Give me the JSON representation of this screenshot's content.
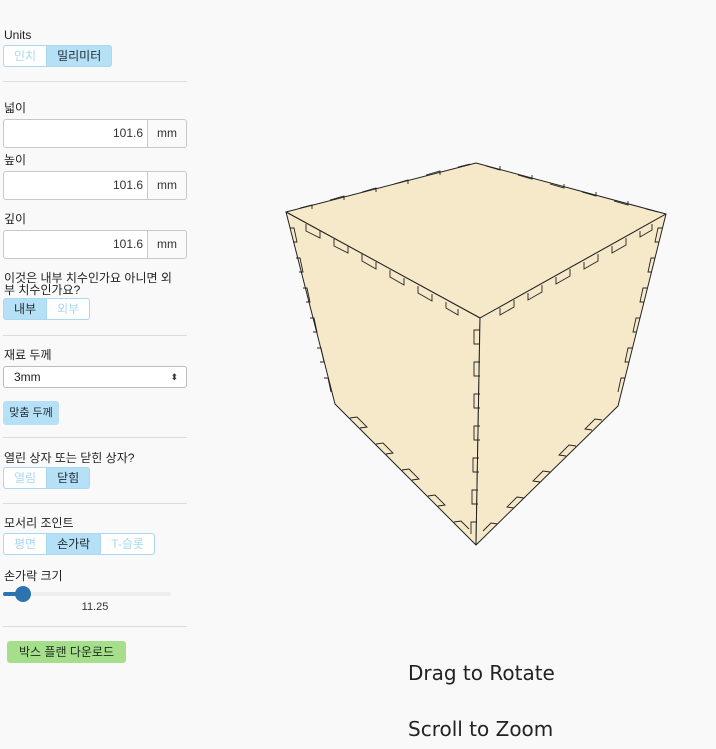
{
  "units": {
    "label": "Units",
    "options": [
      "인치",
      "밀리미터"
    ],
    "selected": 1
  },
  "width": {
    "label": "넓이",
    "value": "101.6",
    "unit": "mm"
  },
  "height": {
    "label": "높이",
    "value": "101.6",
    "unit": "mm"
  },
  "depth": {
    "label": "깊이",
    "value": "101.6",
    "unit": "mm"
  },
  "dimension_mode": {
    "label_line1": "이것은 내부 치수인가요 아니면 외",
    "label_line2": "부 치수인가요?",
    "options": [
      "내부",
      "외부"
    ],
    "selected": 0
  },
  "material": {
    "label": "재료 두께",
    "value": "3mm"
  },
  "fit_button": "맞춤 두께",
  "box_type": {
    "label": "열린 상자 또는 닫힌 상자?",
    "options": [
      "열림",
      "닫힘"
    ],
    "selected": 1
  },
  "joint": {
    "label": "모서리 조인트",
    "options": [
      "평면",
      "손가락",
      "T-슬롯"
    ],
    "selected": 1
  },
  "finger": {
    "label": "손가락 크기",
    "value": "11.25",
    "fraction": 0.12
  },
  "download_button": "박스 플랜 다운로드",
  "viewer": {
    "drag_hint": "Drag to Rotate",
    "zoom_hint": "Scroll to Zoom"
  },
  "colors": {
    "accent": "#b5e0f6",
    "download": "#a6df8c",
    "slider": "#2c73b0",
    "box_face": "#f5e9c9"
  }
}
